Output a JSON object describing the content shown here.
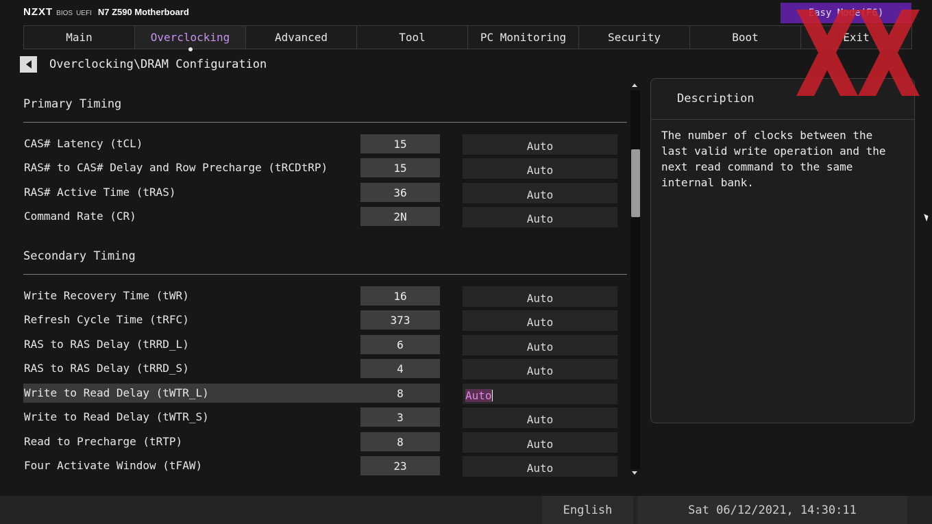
{
  "header": {
    "brand_logo": "NZXT",
    "brand_bios": "BIOS",
    "brand_uefi": "UEFI",
    "model": "N7 Z590 Motherboard",
    "easy_mode": "Easy Mode(F6)"
  },
  "tabs": [
    {
      "label": "Main"
    },
    {
      "label": "Overclocking"
    },
    {
      "label": "Advanced"
    },
    {
      "label": "Tool"
    },
    {
      "label": "PC Monitoring"
    },
    {
      "label": "Security"
    },
    {
      "label": "Boot"
    },
    {
      "label": "Exit"
    }
  ],
  "active_tab": "Overclocking",
  "breadcrumb": "Overclocking\\DRAM Configuration",
  "primary": {
    "title": "Primary Timing",
    "rows": [
      {
        "label": "CAS# Latency (tCL)",
        "value": "15",
        "mode": "Auto"
      },
      {
        "label": "RAS# to CAS# Delay and Row Precharge (tRCDtRP)",
        "value": "15",
        "mode": "Auto"
      },
      {
        "label": "RAS# Active Time (tRAS)",
        "value": "36",
        "mode": "Auto"
      },
      {
        "label": "Command Rate (CR)",
        "value": "2N",
        "mode": "Auto"
      }
    ]
  },
  "secondary": {
    "title": "Secondary Timing",
    "rows": [
      {
        "label": "Write Recovery Time (tWR)",
        "value": "16",
        "mode": "Auto"
      },
      {
        "label": "Refresh Cycle Time (tRFC)",
        "value": "373",
        "mode": "Auto"
      },
      {
        "label": "RAS to RAS Delay (tRRD_L)",
        "value": "6",
        "mode": "Auto"
      },
      {
        "label": "RAS to RAS Delay (tRRD_S)",
        "value": "4",
        "mode": "Auto"
      },
      {
        "label": "Write to Read Delay (tWTR_L)",
        "value": "8",
        "mode": "Auto"
      },
      {
        "label": "Write to Read Delay (tWTR_S)",
        "value": "3",
        "mode": "Auto"
      },
      {
        "label": "Read to Precharge (tRTP)",
        "value": "8",
        "mode": "Auto"
      },
      {
        "label": "Four Activate Window (tFAW)",
        "value": "23",
        "mode": "Auto"
      }
    ]
  },
  "description": {
    "title": "Description",
    "text": "The number of clocks between the last valid write operation and the next read command to the same internal bank."
  },
  "footer": {
    "language": "English",
    "datetime": "Sat 06/12/2021, 14:30:11"
  },
  "colors": {
    "accent_purple": "#c892f0",
    "easy_mode_bg": "#5a1f9a",
    "watermark_red": "#c8202a"
  }
}
